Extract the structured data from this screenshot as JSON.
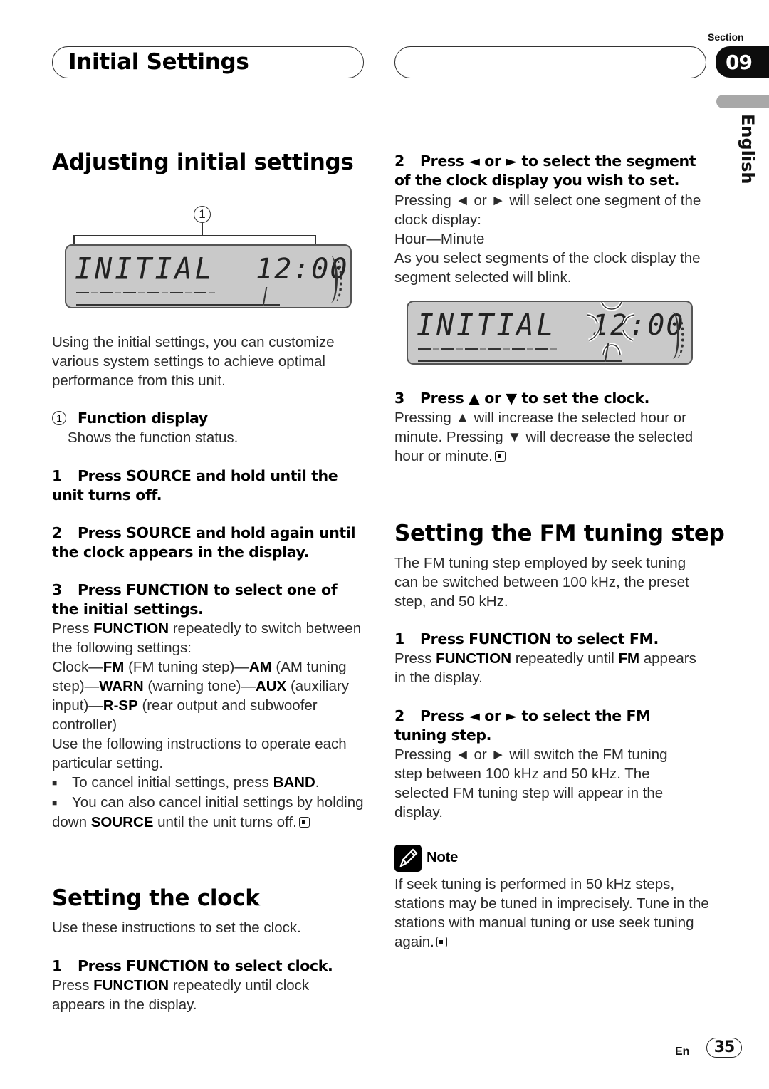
{
  "header": {
    "chapter_title": "Initial Settings",
    "section_label": "Section",
    "section_number": "09",
    "language_tab": "English"
  },
  "left": {
    "heading_adjusting": "Adjusting initial settings",
    "figure1": {
      "callout": "①",
      "display_text": "INITIAL",
      "display_clock": "12:00"
    },
    "intro": "Using the initial settings, you can customize various system settings to achieve optimal performance from this unit.",
    "callout_item": {
      "marker": "①",
      "title": "Function display",
      "desc": "Shows the function status."
    },
    "steps": [
      {
        "num": "1",
        "title": "Press SOURCE and hold until the unit turns off."
      },
      {
        "num": "2",
        "title": "Press SOURCE and hold again until the clock appears in the display."
      },
      {
        "num": "3",
        "title": "Press FUNCTION to select one of the initial settings."
      }
    ],
    "step3_body": {
      "line1_pre": "Press ",
      "line1_bold": "FUNCTION",
      "line1_post": " repeatedly to switch between the following settings:",
      "seq": [
        {
          "text": "Clock—"
        },
        {
          "bold": "FM"
        },
        {
          "text": " (FM tuning step)—"
        },
        {
          "bold": "AM"
        },
        {
          "text": " (AM tuning step)—"
        },
        {
          "bold": "WARN"
        },
        {
          "text": " (warning tone)—"
        },
        {
          "bold": "AUX"
        },
        {
          "text": " (auxiliary input)—"
        },
        {
          "bold": "R-SP"
        },
        {
          "text": " (rear output and subwoofer controller)"
        }
      ],
      "instructions": "Use the following instructions to operate each particular setting.",
      "bullet1_pre": "To cancel initial settings, press ",
      "bullet1_bold": "BAND",
      "bullet1_post": ".",
      "bullet2_pre": "You can also cancel initial settings by holding down ",
      "bullet2_bold": "SOURCE",
      "bullet2_post": " until the unit turns off."
    },
    "heading_clock": "Setting the clock",
    "clock_intro": "Use these instructions to set the clock.",
    "clock_step1": {
      "num": "1",
      "title": "Press FUNCTION to select clock."
    },
    "clock_step1_body": {
      "pre": "Press ",
      "bold": "FUNCTION",
      "post": " repeatedly until clock appears in the display."
    }
  },
  "right": {
    "clock_step2": {
      "num": "2",
      "title": "Press ◄ or ► to select the segment of the clock display you wish to set."
    },
    "clock_step2_body": [
      "Pressing ◄ or ► will select one segment of the clock display:",
      "Hour—Minute",
      "As you select segments of the clock display the segment selected will blink."
    ],
    "figure2": {
      "display_text": "INITIAL",
      "display_clock": "12:00"
    },
    "clock_step3": {
      "num": "3",
      "title": "Press ▲ or ▼ to set the clock."
    },
    "clock_step3_body": "Pressing ▲ will increase the selected hour or minute. Pressing ▼ will decrease the selected hour or minute.",
    "heading_fm": "Setting the FM tuning step",
    "fm_intro": "The FM tuning step employed by seek tuning can be switched between 100 kHz, the preset step, and 50 kHz.",
    "fm_step1": {
      "num": "1",
      "title": "Press FUNCTION to select FM."
    },
    "fm_step1_body": {
      "pre": "Press ",
      "bold1": "FUNCTION",
      "mid": " repeatedly until ",
      "bold2": "FM",
      "post": " appears in the display."
    },
    "fm_step2": {
      "num": "2",
      "title": "Press ◄ or ► to select the FM tuning step."
    },
    "fm_step2_body": "Pressing ◄ or ► will switch the FM tuning step between 100 kHz and 50 kHz. The selected FM tuning step will appear in the display.",
    "note": {
      "icon": "pencil-icon",
      "title": "Note",
      "body": "If seek tuning is performed in 50 kHz steps, stations may be tuned in imprecisely. Tune in the stations with manual tuning or use seek tuning again."
    }
  },
  "footer": {
    "lang_code": "En",
    "page_number": "35"
  }
}
